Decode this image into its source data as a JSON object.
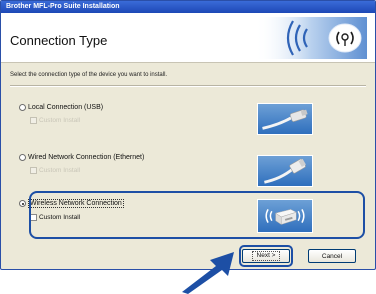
{
  "window": {
    "title": "Brother MFL-Pro Suite Installation"
  },
  "header": {
    "title": "Connection Type",
    "logo_icon": "wireless-signal-logo-icon"
  },
  "instruction": "Select the connection type of the device you want to install.",
  "options": [
    {
      "label": "Local Connection (USB)",
      "selected": false,
      "sub_label": "Custom Install",
      "sub_enabled": false,
      "sub_checked": false,
      "image_icon": "usb-cable-icon"
    },
    {
      "label": "Wired Network Connection (Ethernet)",
      "selected": false,
      "sub_label": "Custom Install",
      "sub_enabled": false,
      "sub_checked": false,
      "image_icon": "ethernet-cable-icon"
    },
    {
      "label": "Wireless Network Connection",
      "selected": true,
      "sub_label": "Custom Install",
      "sub_enabled": true,
      "sub_checked": false,
      "image_icon": "wireless-printer-icon"
    }
  ],
  "buttons": {
    "next": "Next >",
    "cancel": "Cancel"
  },
  "colors": {
    "titlebar": "#1d48b6",
    "highlight": "#1d4fa5",
    "arrow": "#1d4fa5"
  }
}
